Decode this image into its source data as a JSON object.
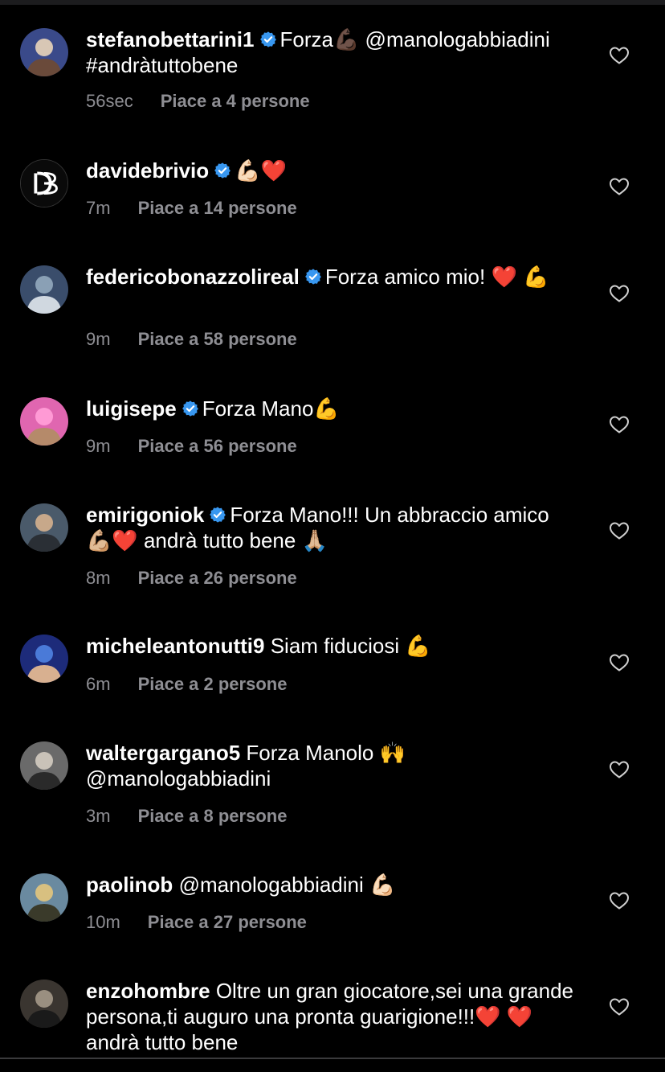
{
  "colors": {
    "background": "#000000",
    "text": "#ffffff",
    "muted": "#8e8e93",
    "verified": "#3897f0"
  },
  "comments": [
    {
      "username": "stefanobettarini1",
      "verified": true,
      "text": "Forza💪🏿 @manologabbiadini #andràtuttobene",
      "time": "56sec",
      "likes": "Piace a 4 persone",
      "avatar": "avatar-photo"
    },
    {
      "username": "davidebrivio",
      "verified": true,
      "text": "💪🏻❤️",
      "time": "7m",
      "likes": "Piace a 14 persone",
      "avatar": "db-logo"
    },
    {
      "username": "federicobonazzolireal",
      "verified": true,
      "text": "Forza amico mio! ❤️ 💪",
      "time": "9m",
      "likes": "Piace a 58 persone",
      "avatar": "avatar-photo"
    },
    {
      "username": "luigisepe",
      "verified": true,
      "text": "Forza Mano💪",
      "time": "9m",
      "likes": "Piace a 56 persone",
      "avatar": "avatar-photo"
    },
    {
      "username": "emirigoniok",
      "verified": true,
      "text": "Forza Mano!!! Un abbraccio amico 💪🏼❤️ andrà tutto bene 🙏🏼",
      "time": "8m",
      "likes": "Piace a 26 persone",
      "avatar": "avatar-photo"
    },
    {
      "username": "micheleantonutti9",
      "verified": false,
      "text": "Siam fiduciosi 💪",
      "time": "6m",
      "likes": "Piace a 2 persone",
      "avatar": "avatar-photo"
    },
    {
      "username": "waltergargano5",
      "verified": false,
      "text": "Forza Manolo 🙌 @manologabbiadini",
      "time": "3m",
      "likes": "Piace a 8 persone",
      "avatar": "avatar-photo"
    },
    {
      "username": "paolinob",
      "verified": false,
      "text": "@manologabbiadini 💪🏻",
      "time": "10m",
      "likes": "Piace a 27 persone",
      "avatar": "avatar-photo"
    },
    {
      "username": "enzohombre",
      "verified": false,
      "text": "Oltre un gran giocatore,sei una grande persona,ti auguro una pronta guarigione!!!❤️ ❤️ andrà tutto bene",
      "time": "",
      "likes": "",
      "avatar": "avatar-photo"
    }
  ]
}
